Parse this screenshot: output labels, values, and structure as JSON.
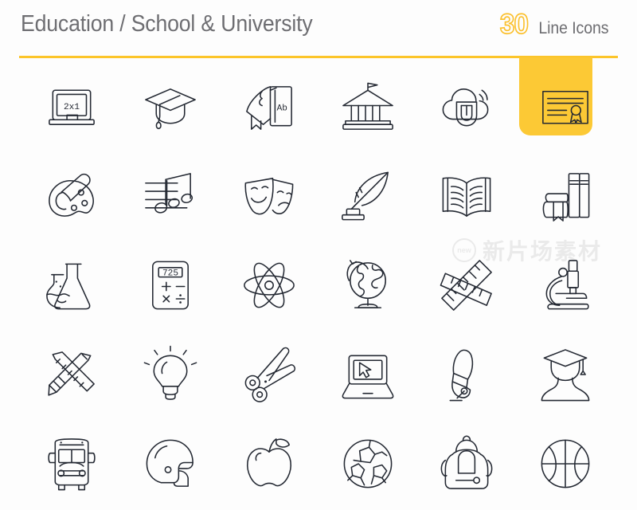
{
  "header": {
    "title": "Education / School & University",
    "count": "30",
    "count_label": "Line Icons"
  },
  "theme": {
    "accent_yellow": "#fcc52a",
    "highlight_yellow": "#fcc935",
    "icon_stroke": "#242933",
    "title_gray": "#6e6e72",
    "background": "#ffffff"
  },
  "watermark": {
    "badge": "new",
    "text": "新片场素材"
  },
  "grid": {
    "columns": 6,
    "rows": 5,
    "total": 30,
    "highlighted_index": 5
  },
  "icons": [
    {
      "index": 0,
      "name": "blackboard-icon",
      "label": "Blackboard",
      "inner_text": "2x1",
      "highlighted": false
    },
    {
      "index": 1,
      "name": "graduation-cap-icon",
      "label": "Graduation Cap",
      "inner_text": "",
      "highlighted": false
    },
    {
      "index": 2,
      "name": "books-abc-icon",
      "label": "Books",
      "inner_text": "Ab",
      "highlighted": false
    },
    {
      "index": 3,
      "name": "university-building-icon",
      "label": "University",
      "inner_text": "",
      "highlighted": false
    },
    {
      "index": 4,
      "name": "cloud-learning-icon",
      "label": "Cloud Learning",
      "inner_text": "U",
      "highlighted": false
    },
    {
      "index": 5,
      "name": "diploma-certificate-icon",
      "label": "Diploma",
      "inner_text": "",
      "highlighted": true
    },
    {
      "index": 6,
      "name": "art-palette-icon",
      "label": "Art Palette",
      "inner_text": "",
      "highlighted": false
    },
    {
      "index": 7,
      "name": "music-notes-icon",
      "label": "Music",
      "inner_text": "",
      "highlighted": false
    },
    {
      "index": 8,
      "name": "theater-masks-icon",
      "label": "Theater Masks",
      "inner_text": "",
      "highlighted": false
    },
    {
      "index": 9,
      "name": "quill-inkwell-icon",
      "label": "Quill & Inkwell",
      "inner_text": "",
      "highlighted": false
    },
    {
      "index": 10,
      "name": "open-book-icon",
      "label": "Open Book",
      "inner_text": "",
      "highlighted": false
    },
    {
      "index": 11,
      "name": "bookshelf-icon",
      "label": "Bookshelf",
      "inner_text": "",
      "highlighted": false
    },
    {
      "index": 12,
      "name": "chemistry-flasks-icon",
      "label": "Chemistry",
      "inner_text": "",
      "highlighted": false
    },
    {
      "index": 13,
      "name": "calculator-icon",
      "label": "Calculator",
      "inner_text": "725",
      "highlighted": false
    },
    {
      "index": 14,
      "name": "atom-icon",
      "label": "Atom",
      "inner_text": "",
      "highlighted": false
    },
    {
      "index": 15,
      "name": "globe-stand-icon",
      "label": "Globe",
      "inner_text": "",
      "highlighted": false
    },
    {
      "index": 16,
      "name": "rulers-icon",
      "label": "Rulers",
      "inner_text": "",
      "highlighted": false
    },
    {
      "index": 17,
      "name": "microscope-icon",
      "label": "Microscope",
      "inner_text": "",
      "highlighted": false
    },
    {
      "index": 18,
      "name": "pencil-ruler-icon",
      "label": "Pencil & Ruler",
      "inner_text": "",
      "highlighted": false
    },
    {
      "index": 19,
      "name": "light-bulb-icon",
      "label": "Idea",
      "inner_text": "",
      "highlighted": false
    },
    {
      "index": 20,
      "name": "scissors-icon",
      "label": "Scissors",
      "inner_text": "",
      "highlighted": false
    },
    {
      "index": 21,
      "name": "laptop-cursor-icon",
      "label": "E-Learning Laptop",
      "inner_text": "",
      "highlighted": false
    },
    {
      "index": 22,
      "name": "fountain-pen-icon",
      "label": "Fountain Pen",
      "inner_text": "",
      "highlighted": false
    },
    {
      "index": 23,
      "name": "graduate-person-icon",
      "label": "Graduate",
      "inner_text": "",
      "highlighted": false
    },
    {
      "index": 24,
      "name": "school-bus-icon",
      "label": "School Bus",
      "inner_text": "",
      "highlighted": false
    },
    {
      "index": 25,
      "name": "football-helmet-icon",
      "label": "Football Helmet",
      "inner_text": "",
      "highlighted": false
    },
    {
      "index": 26,
      "name": "apple-icon",
      "label": "Apple",
      "inner_text": "",
      "highlighted": false
    },
    {
      "index": 27,
      "name": "soccer-ball-icon",
      "label": "Soccer Ball",
      "inner_text": "",
      "highlighted": false
    },
    {
      "index": 28,
      "name": "backpack-icon",
      "label": "Backpack",
      "inner_text": "",
      "highlighted": false
    },
    {
      "index": 29,
      "name": "basketball-icon",
      "label": "Basketball",
      "inner_text": "",
      "highlighted": false
    }
  ]
}
